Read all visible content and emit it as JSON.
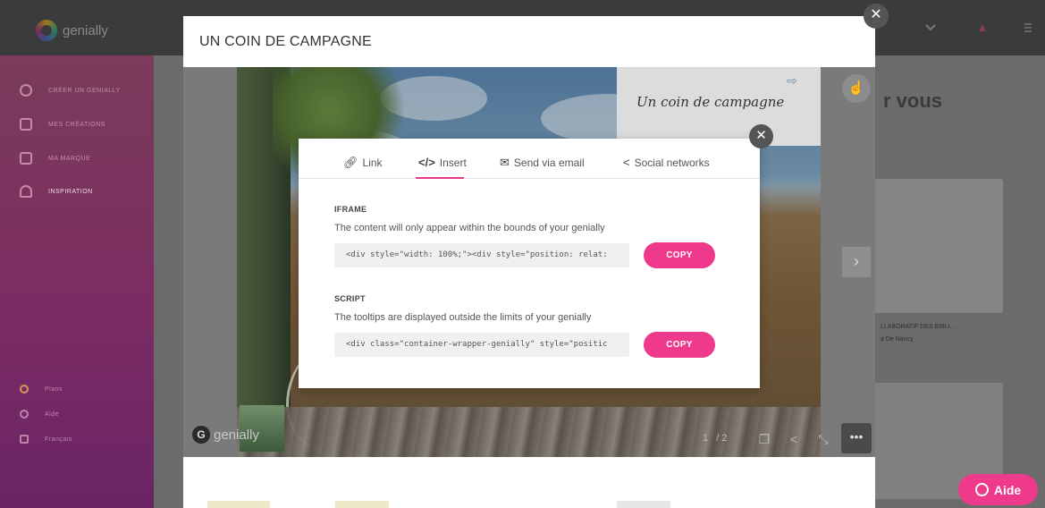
{
  "app": {
    "logo_text": "genially",
    "sidebar": {
      "items": [
        {
          "label": "CRÉER UN GENIALLY"
        },
        {
          "label": "MES CRÉATIONS"
        },
        {
          "label": "MA MARQUE"
        },
        {
          "label": "INSPIRATION"
        }
      ],
      "footer": [
        {
          "label": "Plans"
        },
        {
          "label": "Aide"
        },
        {
          "label": "Français"
        }
      ]
    },
    "background_heading": "r vous",
    "background_card_text": "LLABORATIF DES BIBLI...",
    "background_card_sub": "a De Nancy"
  },
  "preview": {
    "title": "UN COIN DE CAMPAGNE",
    "note_text": "Un coin de campagne",
    "logo_text": "genially",
    "pager": {
      "current": "1",
      "total": "/ 2"
    }
  },
  "share_dialog": {
    "tabs": [
      {
        "label": "Link",
        "icon": "link-icon"
      },
      {
        "label": "Insert",
        "icon": "code-icon"
      },
      {
        "label": "Send via email",
        "icon": "mail-icon"
      },
      {
        "label": "Social networks",
        "icon": "share-icon"
      }
    ],
    "active_tab": "Insert",
    "iframe": {
      "heading": "IFRAME",
      "description": "The content will only appear within the bounds of your genially",
      "code": "<div style=\"width: 100%;\"><div style=\"position: relat:",
      "copy_label": "COPY"
    },
    "script": {
      "heading": "SCRIPT",
      "description": "The tooltips are displayed outside the limits of your genially",
      "code": "<div class=\"container-wrapper-genially\" style=\"positic",
      "copy_label": "COPY"
    }
  },
  "help_button": {
    "label": "Aide"
  },
  "colors": {
    "accent_pink": "#ef3a8c",
    "tab_underline": "#e8388a"
  }
}
